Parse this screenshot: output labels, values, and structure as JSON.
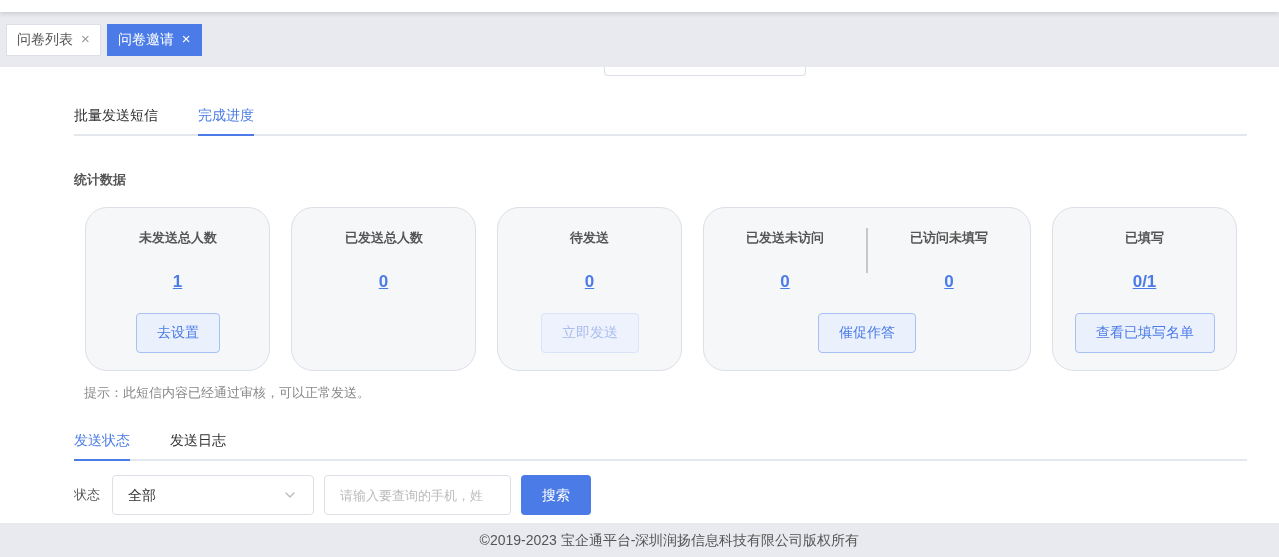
{
  "page_tabs": [
    {
      "label": "问卷列表",
      "close": "×",
      "selected": false
    },
    {
      "label": "问卷邀请",
      "close": "×",
      "selected": true
    }
  ],
  "section_tabs": [
    {
      "label": "批量发送短信",
      "selected": false
    },
    {
      "label": "完成进度",
      "selected": true
    }
  ],
  "stats_title": "统计数据",
  "cards": [
    {
      "metrics": [
        {
          "label": "未发送总人数",
          "value": "1"
        }
      ],
      "button": {
        "label": "去设置",
        "disabled": false
      }
    },
    {
      "metrics": [
        {
          "label": "已发送总人数",
          "value": "0"
        }
      ]
    },
    {
      "metrics": [
        {
          "label": "待发送",
          "value": "0"
        }
      ],
      "button": {
        "label": "立即发送",
        "disabled": true
      }
    },
    {
      "metrics": [
        {
          "label": "已发送未访问",
          "value": "0"
        },
        {
          "label": "已访问未填写",
          "value": "0"
        }
      ],
      "button": {
        "label": "催促作答",
        "disabled": false
      }
    },
    {
      "metrics": [
        {
          "label": "已填写",
          "value": "0/1"
        }
      ],
      "button": {
        "label": "查看已填写名单",
        "disabled": false
      }
    }
  ],
  "hint": "提示：此短信内容已经通过审核，可以正常发送。",
  "log_tabs": [
    {
      "label": "发送状态",
      "selected": true
    },
    {
      "label": "发送日志",
      "selected": false
    }
  ],
  "filter": {
    "status_label": "状态",
    "status_value": "全部",
    "search_placeholder": "请输入要查询的手机，姓",
    "search_button": "搜索"
  },
  "footer": "©2019-2023 宝企通平台-深圳润扬信息科技有限公司版权所有"
}
